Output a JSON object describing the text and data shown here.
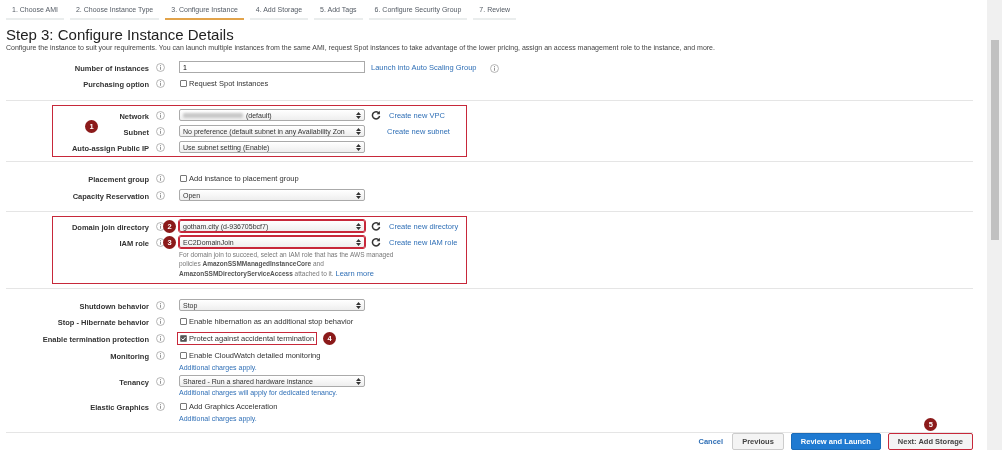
{
  "steps": [
    {
      "label": "1. Choose AMI",
      "selected": false
    },
    {
      "label": "2. Choose Instance Type",
      "selected": false
    },
    {
      "label": "3. Configure Instance",
      "selected": true
    },
    {
      "label": "4. Add Storage",
      "selected": false
    },
    {
      "label": "5. Add Tags",
      "selected": false
    },
    {
      "label": "6. Configure Security Group",
      "selected": false
    },
    {
      "label": "7. Review",
      "selected": false
    }
  ],
  "title": "Step 3: Configure Instance Details",
  "description": "Configure the instance to suit your requirements. You can launch multiple instances from the same AMI, request Spot instances to take advantage of the lower pricing, assign an access management role to the instance, and more.",
  "sections": [
    {
      "framed": false,
      "rows": [
        {
          "label": "Number of instances",
          "kind": "text",
          "value": "1",
          "link": "Launch into Auto Scaling Group",
          "link_info": true
        },
        {
          "label": "Purchasing option",
          "kind": "checkbox",
          "value": "Request Spot instances",
          "checked": false
        }
      ]
    },
    {
      "framed": true,
      "badge": "1",
      "rows": [
        {
          "label": "Network",
          "kind": "select",
          "value": "(default)",
          "blurred": true,
          "refresh": true,
          "link": "Create new VPC"
        },
        {
          "label": "Subnet",
          "kind": "select",
          "value": "No preference (default subnet in any Availability Zon",
          "link": "Create new subnet"
        },
        {
          "label": "Auto-assign Public IP",
          "kind": "select",
          "value": "Use subnet setting (Enable)"
        }
      ]
    },
    {
      "framed": false,
      "rows": [
        {
          "label": "Placement group",
          "kind": "checkbox",
          "value": "Add instance to placement group",
          "checked": false
        },
        {
          "label": "Capacity Reservation",
          "kind": "select",
          "value": "Open"
        }
      ]
    },
    {
      "framed": true,
      "rows": [
        {
          "label": "Domain join directory",
          "kind": "select",
          "value": "gotham.city (d-936705bcf7)",
          "framed": true,
          "badge": "2",
          "refresh": true,
          "link": "Create new directory"
        },
        {
          "label": "IAM role",
          "kind": "select",
          "value": "EC2DomainJoin",
          "framed": true,
          "badge": "3",
          "refresh": true,
          "link": "Create new IAM role",
          "help": "For domain join to succeed, select an IAM role that has the AWS managed policies **AmazonSSMManagedInstanceCore** and **AmazonSSMDirectoryServiceAccess** attached to it.",
          "help_link": "Learn more"
        }
      ]
    },
    {
      "framed": false,
      "rows": [
        {
          "label": "Shutdown behavior",
          "kind": "select",
          "value": "Stop"
        },
        {
          "label": "Stop - Hibernate behavior",
          "kind": "checkbox",
          "value": "Enable hibernation as an additional stop behavior",
          "checked": false
        },
        {
          "label": "Enable termination protection",
          "kind": "checkbox",
          "value": "Protect against accidental termination",
          "checked": true,
          "framed": true,
          "badge": "4"
        },
        {
          "label": "Monitoring",
          "kind": "checkbox",
          "value": "Enable CloudWatch detailed monitoring",
          "checked": false,
          "note": "Additional charges apply."
        },
        {
          "label": "Tenancy",
          "kind": "select",
          "value": "Shared - Run a shared hardware instance",
          "note": "Additional charges will apply for dedicated tenancy."
        },
        {
          "label": "Elastic Graphics",
          "kind": "checkbox",
          "value": "Add Graphics Acceleration",
          "checked": false,
          "note": "Additional charges apply."
        }
      ]
    }
  ],
  "footer": {
    "buttons": [
      {
        "label": "Cancel",
        "kind": "link"
      },
      {
        "label": "Previous",
        "kind": "default"
      },
      {
        "label": "Review and Launch",
        "kind": "primary"
      },
      {
        "label": "Next: Add Storage",
        "kind": "default",
        "framed": true,
        "badge": "5"
      }
    ]
  }
}
